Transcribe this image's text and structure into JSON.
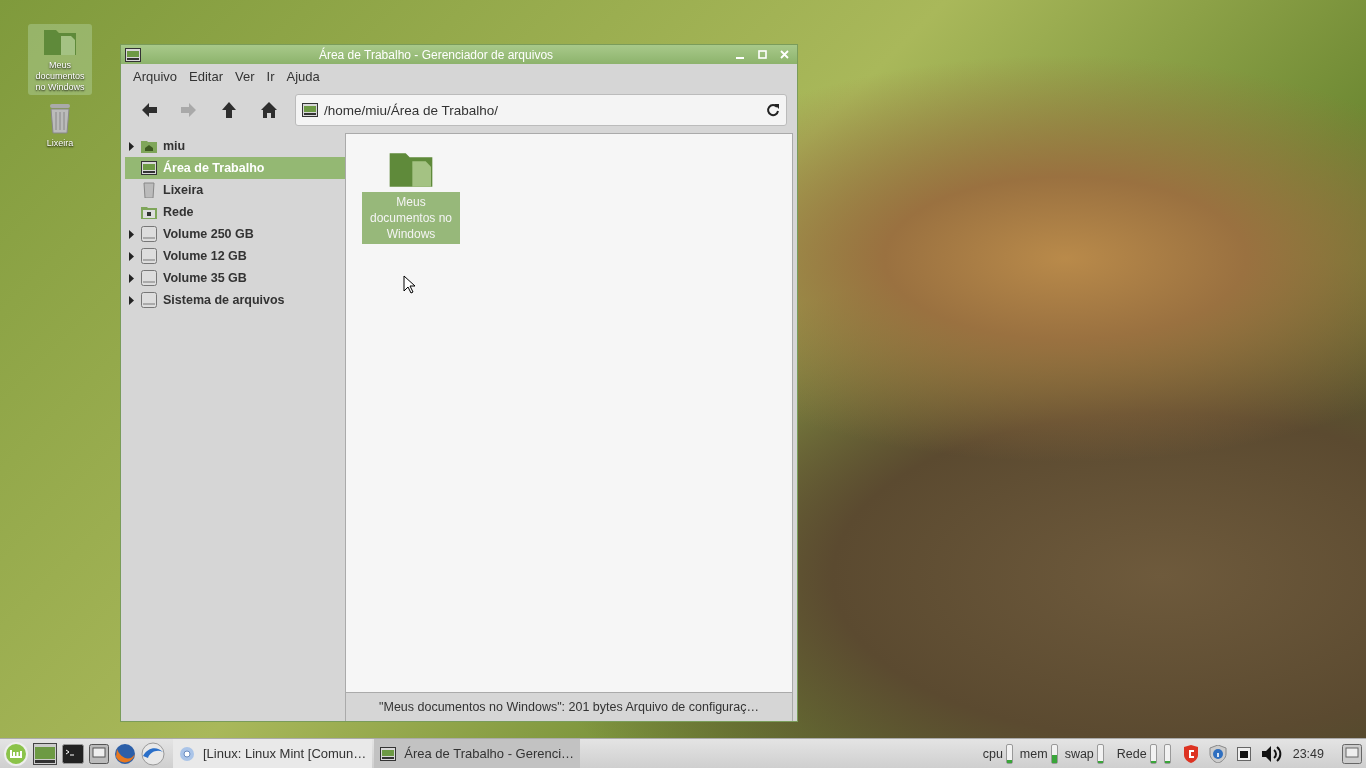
{
  "desktop_icons": [
    {
      "label": "Meus documentos no Windows",
      "kind": "folder",
      "selected": true
    },
    {
      "label": "Lixeira",
      "kind": "trash",
      "selected": false
    }
  ],
  "window": {
    "title": "Área de Trabalho - Gerenciador de arquivos",
    "menu": [
      "Arquivo",
      "Editar",
      "Ver",
      "Ir",
      "Ajuda"
    ],
    "toolbar": [
      {
        "kind": "back",
        "disabled": false
      },
      {
        "kind": "forward",
        "disabled": true
      },
      {
        "kind": "up",
        "disabled": false
      },
      {
        "kind": "home",
        "disabled": false
      }
    ],
    "location": "/home/miu/Área de Trabalho/",
    "sidebar": [
      {
        "label": "miu",
        "kind": "home",
        "expandable": true,
        "selected": false
      },
      {
        "label": "Área de Trabalho",
        "kind": "desktop",
        "expandable": false,
        "selected": true
      },
      {
        "label": "Lixeira",
        "kind": "trash",
        "expandable": false,
        "selected": false
      },
      {
        "label": "Rede",
        "kind": "network",
        "expandable": false,
        "selected": false
      },
      {
        "label": "Volume 250 GB",
        "kind": "drive",
        "expandable": true,
        "selected": false
      },
      {
        "label": "Volume 12 GB",
        "kind": "drive",
        "expandable": true,
        "selected": false
      },
      {
        "label": "Volume 35 GB",
        "kind": "drive",
        "expandable": true,
        "selected": false
      },
      {
        "label": "Sistema de arquivos",
        "kind": "drive",
        "expandable": true,
        "selected": false
      }
    ],
    "files": [
      {
        "label": "Meus documentos no Windows",
        "selected": true
      }
    ],
    "status_bar": "\"Meus documentos no Windows\": 201 bytes Arquivo de configuraç…"
  },
  "taskbar": {
    "launchers": [
      {
        "kind": "menu"
      },
      {
        "kind": "files"
      },
      {
        "kind": "terminal"
      },
      {
        "kind": "computer"
      },
      {
        "kind": "firefox"
      },
      {
        "kind": "thunderbird"
      }
    ],
    "windows": [
      {
        "label": "[Linux: Linux Mint [Comun…",
        "kind": "browser",
        "selected": false
      },
      {
        "label": "Área de Trabalho - Gerenci…",
        "kind": "files",
        "selected": true
      }
    ],
    "meters": [
      {
        "label": "cpu",
        "level": 0.05
      },
      {
        "label": "mem",
        "level": 0.35
      },
      {
        "label": "swap",
        "level": 0.0
      }
    ],
    "network": {
      "label": "Rede",
      "meters": [
        {
          "level": 0.0
        },
        {
          "level": 0.0
        }
      ]
    },
    "tray": [
      {
        "kind": "antivirus"
      },
      {
        "kind": "shield"
      },
      {
        "kind": "network"
      },
      {
        "kind": "volume"
      }
    ],
    "clock": "23:49"
  }
}
